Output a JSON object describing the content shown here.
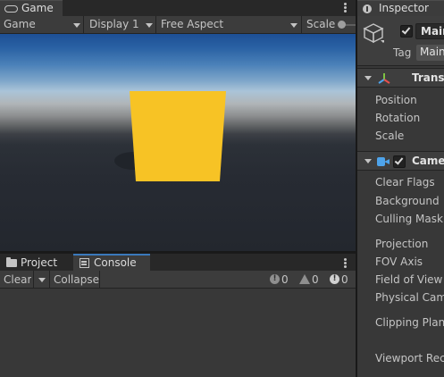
{
  "game_panel": {
    "tab_label": "Game",
    "tab_icon": "gamepad-icon",
    "toolbar": {
      "mode": "Game",
      "display": "Display 1",
      "aspect": "Free Aspect",
      "scale_label": "Scale"
    },
    "scene": {
      "cube_color": "#f7c325",
      "sky_top_color": "#1d4f95",
      "horizon_color": "#b0b5b8",
      "ground_color": "#23272e"
    }
  },
  "bottom_panel": {
    "tabs": [
      {
        "label": "Project",
        "icon": "folder-icon"
      },
      {
        "label": "Console",
        "icon": "console-icon",
        "active": true
      }
    ],
    "toolbar": {
      "clear_label": "Clear",
      "collapse_label": "Collapse",
      "error_count": "0",
      "warning_count": "0",
      "info_count": "0"
    }
  },
  "inspector": {
    "tab_label": "Inspector",
    "tab_icon": "info-icon",
    "object": {
      "name": "Main Camera",
      "active": true,
      "tag_label": "Tag",
      "tag_value": "MainCamera"
    },
    "components": [
      {
        "title": "Transform",
        "icon": "transform-icon",
        "properties": [
          "Position",
          "Rotation",
          "Scale"
        ]
      },
      {
        "title": "Camera",
        "icon": "camera-icon",
        "enabled": true,
        "properties": [
          "Clear Flags",
          "Background",
          "Culling Mask",
          "Projection",
          "FOV Axis",
          "Field of View",
          "Physical Camera",
          "Clipping Planes",
          "Viewport Rect"
        ]
      }
    ]
  }
}
